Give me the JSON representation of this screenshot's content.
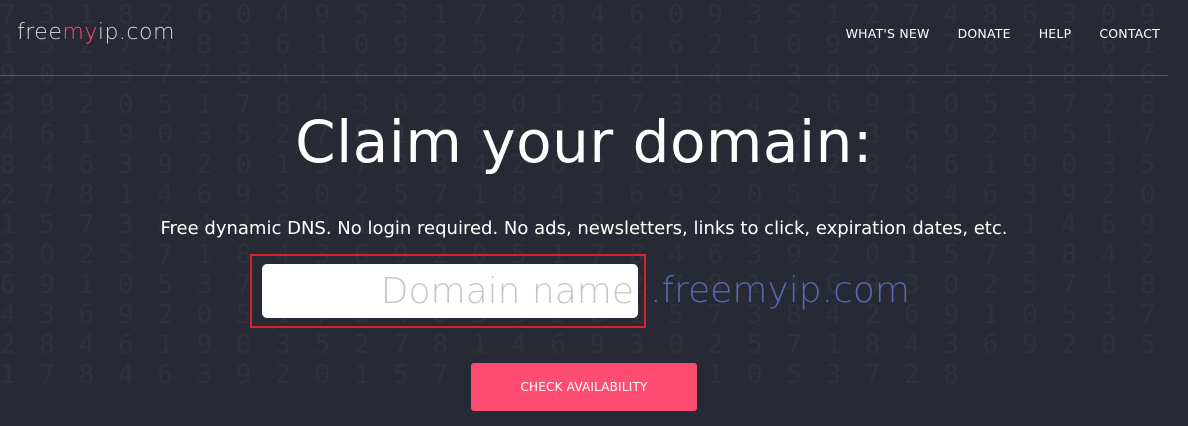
{
  "header": {
    "logo": {
      "part1": "free",
      "part2": "my",
      "part3": "ip.com"
    },
    "nav": [
      "WHAT'S NEW",
      "DONATE",
      "HELP",
      "CONTACT"
    ]
  },
  "hero": {
    "title": "Claim your domain:",
    "tagline": "Free dynamic DNS. No login required. No ads, newsletters, links to click, expiration dates, etc."
  },
  "form": {
    "placeholder": "Domain name",
    "suffix": ".freemyip.com",
    "button": "CHECK AVAILABILITY"
  },
  "colors": {
    "background": "#272a35",
    "accent": "#ff4d72",
    "suffix": "#5a67b4",
    "highlight_border": "#d8232f"
  }
}
